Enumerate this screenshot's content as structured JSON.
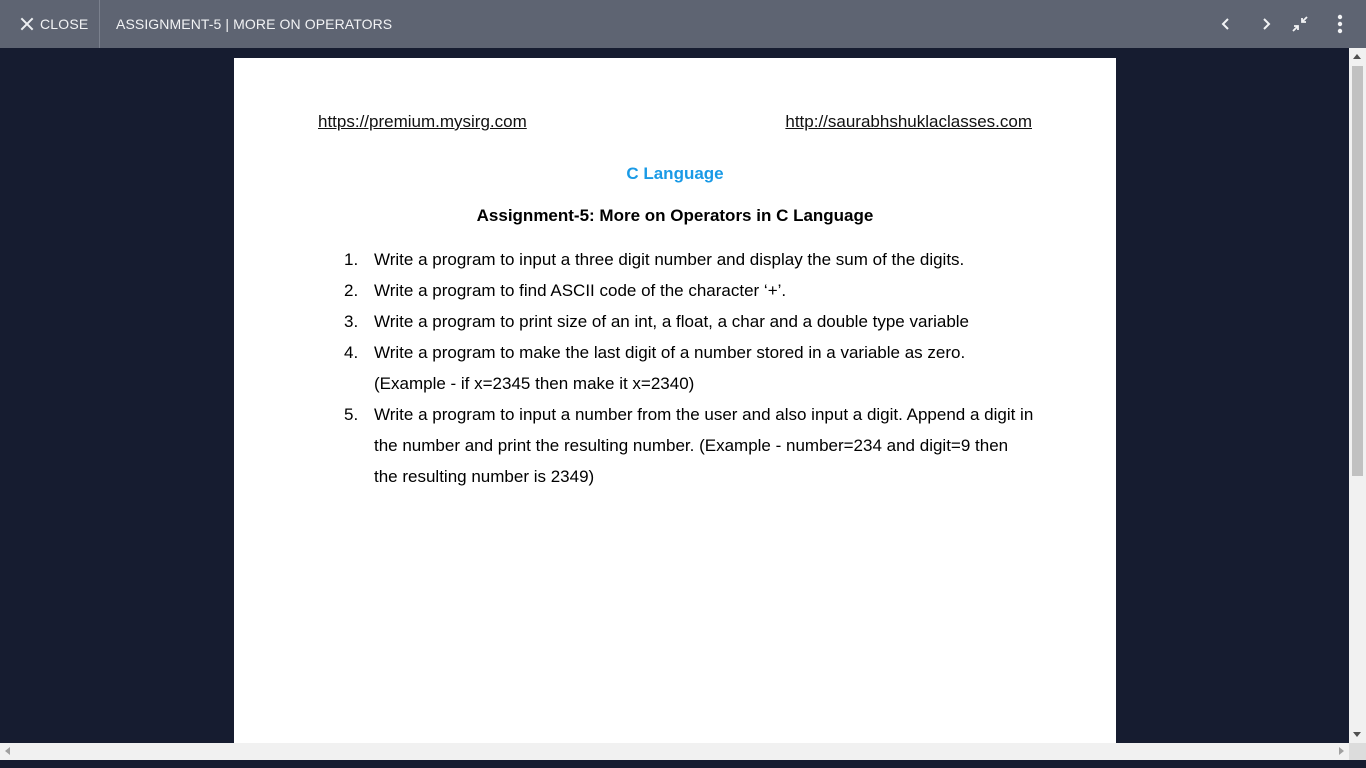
{
  "toolbar": {
    "close_label": "CLOSE",
    "title": "ASSIGNMENT-5 | MORE ON OPERATORS",
    "icons": [
      "chevron-left-icon",
      "chevron-right-icon",
      "collapse-icon",
      "more-vert-icon"
    ]
  },
  "document": {
    "link_left": "https://premium.mysirg.com",
    "link_right": "http://saurabhshuklaclasses.com",
    "subject": "C Language",
    "heading": "Assignment-5: More on Operators in C Language",
    "subject_color": "#1a9ae6",
    "questions": [
      {
        "num": "1.",
        "text": "Write a program to input a three digit number and display the sum of the digits."
      },
      {
        "num": "2.",
        "text": "Write a program to find ASCII code of the character ‘+’."
      },
      {
        "num": "3.",
        "text": "Write a program to print size of an int, a float, a char and a double type variable"
      },
      {
        "num": "4.",
        "text": "Write a program to make the last digit of a number stored in a variable as zero. (Example - if x=2345 then make it x=2340)"
      },
      {
        "num": "5.",
        "text": "Write a program to input a number from the user and also input a digit. Append a digit in the number and print the resulting number. (Example - number=234 and digit=9 then the resulting number is 2349)"
      }
    ]
  },
  "colors": {
    "toolbar_bg": "#5e6472",
    "viewer_bg": "#161c30",
    "page_bg": "#ffffff"
  }
}
